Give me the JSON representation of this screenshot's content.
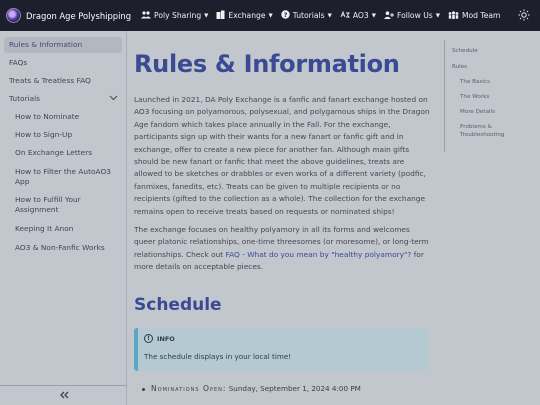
{
  "navbar": {
    "title": "Dragon Age Polyshipping",
    "items": [
      {
        "label": "Poly Sharing",
        "icon": "people-icon"
      },
      {
        "label": "Exchange",
        "icon": "buildings-icon"
      },
      {
        "label": "Tutorials",
        "icon": "question-icon"
      },
      {
        "label": "AO3",
        "icon": "ao3-icon"
      },
      {
        "label": "Follow Us",
        "icon": "user-plus-icon"
      },
      {
        "label": "Mod Team",
        "icon": "team-icon"
      }
    ],
    "theme_icon": "sun-icon"
  },
  "sidebar": {
    "items": [
      {
        "label": "Rules & Information"
      },
      {
        "label": "FAQs"
      },
      {
        "label": "Treats & Treatless FAQ"
      },
      {
        "label": "Tutorials"
      },
      {
        "label": "How to Nominate"
      },
      {
        "label": "How to Sign-Up"
      },
      {
        "label": "On Exchange Letters"
      },
      {
        "label": "How to Filter the AutoAO3 App"
      },
      {
        "label": "How to Fulfill Your Assignment"
      },
      {
        "label": "Keeping It Anon"
      },
      {
        "label": "AO3 & Non-Fanfic Works"
      }
    ],
    "collapse_icon": "double-chevron-left-icon"
  },
  "main": {
    "title": "Rules & Information",
    "para1": "Launched in 2021, DA Poly Exchange is a fanfic and fanart exchange hosted on AO3 focusing on polyamorous, polysexual, and polygamous ships in the Dragon Age fandom which takes place annually in the Fall. For the exchange, participants sign up with their wants for a new fanart or fanfic gift and in exchange, offer to create a new piece for another fan. Although main gifts should be new fanart or fanfic that meet the above guidelines, treats are allowed to be sketches or drabbles or even works of a different variety (podfic, fanmixes, fanedits, etc). Treats can be given to multiple recipients or no recipients (gifted to the collection as a whole). The collection for the exchange remains open to receive treats based on requests or nominated ships!",
    "para2_start": "The exchange focuses on healthy polyamory in all its forms and welcomes queer platonic relationships, one-time threesomes (or moresome), or long-term relationships. Check out ",
    "para2_link": "FAQ - What do you mean by \"healthy polyamory\"?",
    "para2_end": " for more details on acceptable pieces.",
    "schedule_heading": "Schedule",
    "info_label": "INFO",
    "info_text": "The schedule displays in your local time!",
    "schedule": [
      {
        "key": "Nominations Open:",
        "value": "Sunday, September 1, 2024 4:00 PM"
      }
    ]
  },
  "toc": {
    "items": [
      {
        "label": "Schedule"
      },
      {
        "label": "Rules"
      },
      {
        "label": "The Basics"
      },
      {
        "label": "The Works"
      },
      {
        "label": "More Details"
      },
      {
        "label": "Problems & Troubleshooting"
      }
    ]
  }
}
